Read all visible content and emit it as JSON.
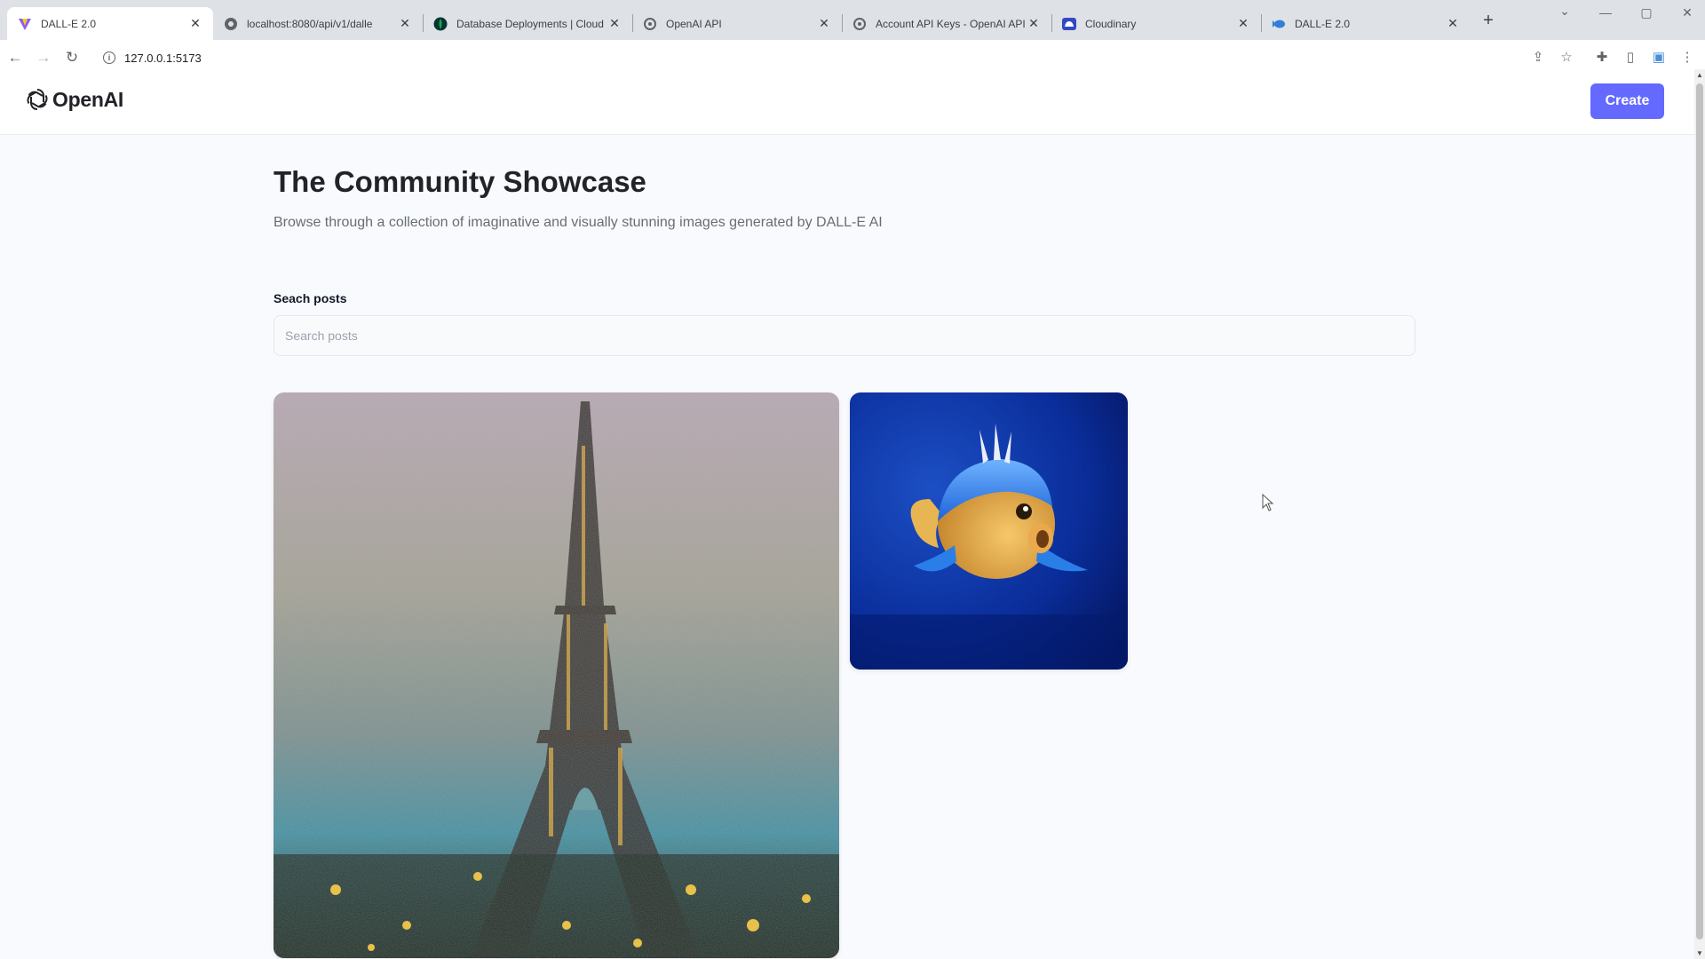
{
  "browser": {
    "tabs": [
      {
        "title": "DALL-E 2.0",
        "icon": "vite-logo-icon",
        "active": true
      },
      {
        "title": "localhost:8080/api/v1/dalle",
        "icon": "globe-icon",
        "active": false
      },
      {
        "title": "Database Deployments | Cloud",
        "icon": "mongodb-leaf-icon",
        "active": false
      },
      {
        "title": "OpenAI API",
        "icon": "openai-logo-icon",
        "active": false
      },
      {
        "title": "Account API Keys - OpenAI API",
        "icon": "openai-logo-icon",
        "active": false
      },
      {
        "title": "Cloudinary",
        "icon": "cloudinary-icon",
        "active": false
      },
      {
        "title": "DALL-E 2.0",
        "icon": "fish-icon",
        "active": false
      }
    ],
    "url": "127.0.0.1:5173"
  },
  "header": {
    "logo_text": "OpenAI",
    "create_label": "Create"
  },
  "main": {
    "title": "The Community Showcase",
    "subtitle": "Browse through a collection of imaginative and visually stunning images generated by DALL-E AI",
    "search": {
      "label": "Seach posts",
      "placeholder": "Search posts",
      "value": ""
    },
    "cards": [
      {
        "subject": "eiffel-tower-painting"
      },
      {
        "subject": "blue-3d-fish"
      }
    ]
  },
  "colors": {
    "accent": "#6469ff",
    "page_bg": "#f9fafe",
    "title": "#222328",
    "subtitle": "#666e75"
  }
}
